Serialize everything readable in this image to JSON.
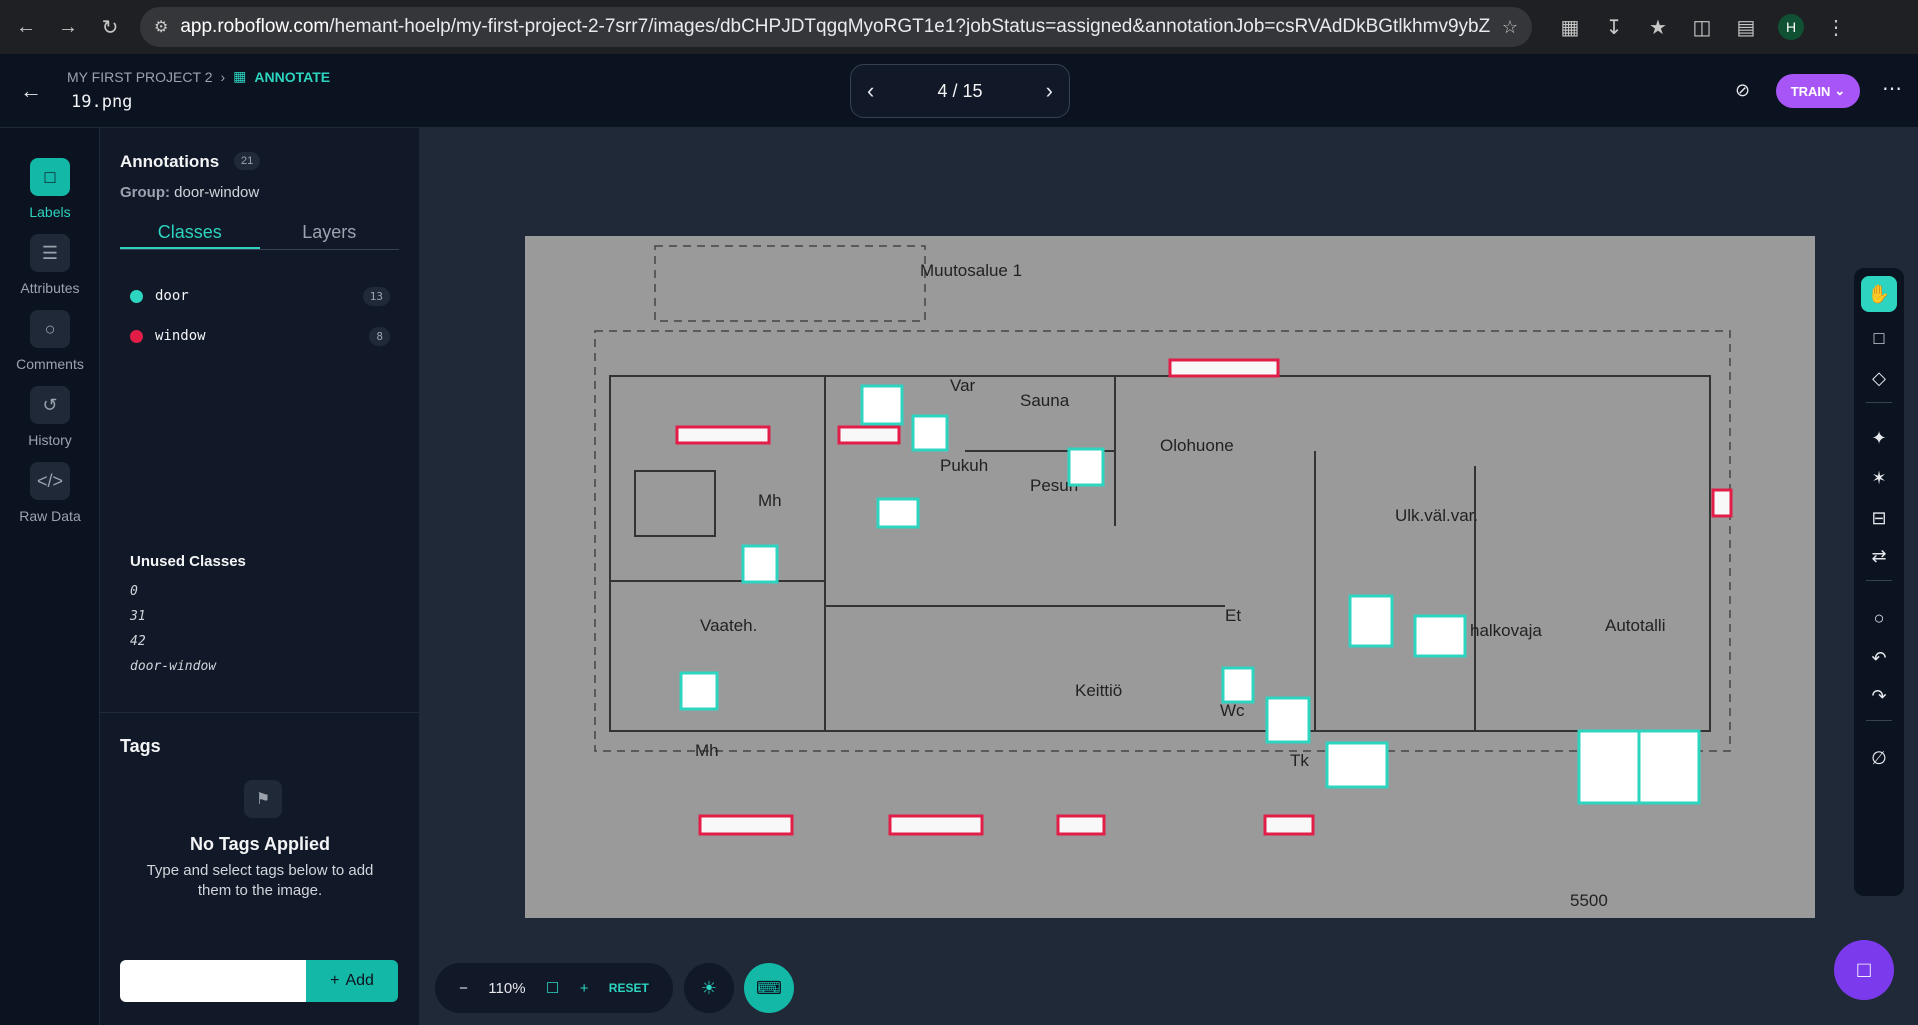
{
  "browser": {
    "url_host": "app.roboflow.com",
    "url_path": "/hemant-hoelp/my-first-project-2-7srr7/images/dbCHPJDTqgqMyoRGT1e1?jobStatus=assigned&annotationJob=csRVAdDkBGtlkhmv9ybZ",
    "avatar_letter": "H"
  },
  "header": {
    "project": "MY FIRST PROJECT 2",
    "section": "ANNOTATE",
    "filename": "19.png",
    "pager": "4 / 15",
    "train_label": "TRAIN"
  },
  "nav": {
    "items": [
      {
        "label": "Labels",
        "icon": "labels-icon"
      },
      {
        "label": "Attributes",
        "icon": "list-icon"
      },
      {
        "label": "Comments",
        "icon": "comment-icon"
      },
      {
        "label": "History",
        "icon": "history-icon"
      },
      {
        "label": "Raw Data",
        "icon": "code-icon"
      }
    ]
  },
  "panel": {
    "title": "Annotations",
    "count": "21",
    "group_label": "Group:",
    "group_value": "door-window",
    "tabs": [
      "Classes",
      "Layers"
    ],
    "classes": [
      {
        "name": "door",
        "count": "13",
        "color": "#2dd4bf"
      },
      {
        "name": "window",
        "count": "8",
        "color": "#e11d48"
      }
    ],
    "unused_title": "Unused Classes",
    "unused": [
      "0",
      "31",
      "42",
      "door-window"
    ]
  },
  "tags": {
    "title": "Tags",
    "empty_title": "No Tags Applied",
    "empty_help": "Type and select tags below to add them to the image.",
    "add_label": "Add"
  },
  "zoom": {
    "value": "110%",
    "reset_label": "RESET"
  },
  "plan": {
    "labels": [
      "Muutosalue 1",
      "Var",
      "Sauna",
      "Olohuone",
      "Pukuh",
      "Pesuh",
      "Mh",
      "Ulk.väl.var.",
      "Vaateh.",
      "Et",
      "halkovaja",
      "Autotalli",
      "Keittiö",
      "Wc",
      "Tk",
      "Mh",
      "5500"
    ]
  }
}
